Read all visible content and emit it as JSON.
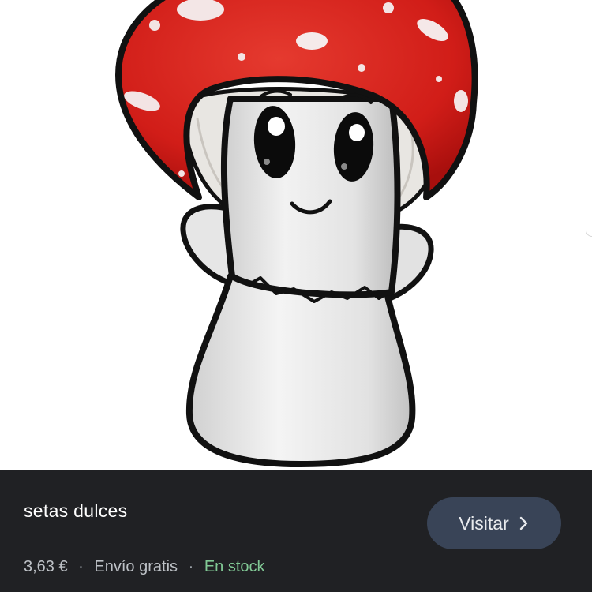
{
  "product": {
    "title": "setas dulces",
    "price": "3,63 €",
    "shipping": "Envío gratis",
    "availability": "En stock"
  },
  "actions": {
    "visit_label": "Visitar",
    "visit_icon": "chevron-right-icon"
  },
  "image": {
    "subject": "mushroom-character-illustration"
  },
  "colors": {
    "panel_bg": "#202124",
    "button_bg": "#394457",
    "stock_green": "#81c995",
    "cap_red": "#d8201c"
  },
  "meta_separator": "·"
}
